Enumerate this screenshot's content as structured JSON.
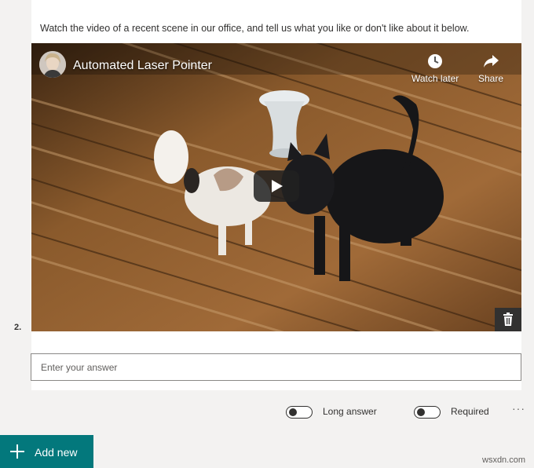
{
  "question": {
    "prompt": "Watch the video of a recent scene in our office, and tell us what you like or don't like about it below.",
    "number": "2.",
    "answer_placeholder": "Enter your answer",
    "answer_value": ""
  },
  "video": {
    "title": "Automated Laser Pointer",
    "watch_later_label": "Watch later",
    "share_label": "Share",
    "icons": {
      "watch_later": "clock-icon",
      "share": "share-arrow-icon",
      "play": "play-icon",
      "delete": "trash-icon"
    }
  },
  "options": {
    "long_answer_label": "Long answer",
    "long_answer_on": false,
    "required_label": "Required",
    "required_on": false,
    "more_label": "···"
  },
  "add_new": {
    "label": "Add new",
    "icon": "plus-icon",
    "color": "#03787c"
  },
  "watermark": "wsxdn.com"
}
